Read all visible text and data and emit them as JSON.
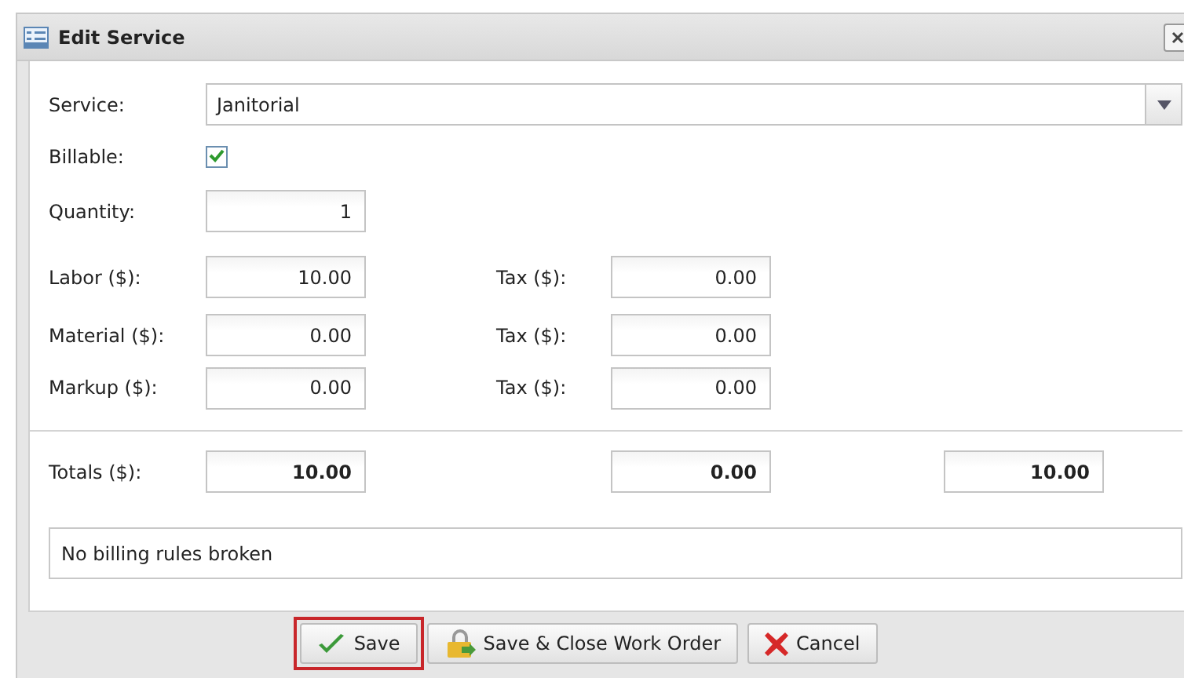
{
  "window": {
    "title": "Edit Service"
  },
  "form": {
    "service": {
      "label": "Service:",
      "value": "Janitorial"
    },
    "billable": {
      "label": "Billable:",
      "checked": true
    },
    "quantity": {
      "label": "Quantity:",
      "value": "1"
    },
    "cost_rows": [
      {
        "label": "Labor ($):",
        "value": "10.00",
        "tax_label": "Tax ($):",
        "tax_value": "0.00"
      },
      {
        "label": "Material ($):",
        "value": "0.00",
        "tax_label": "Tax ($):",
        "tax_value": "0.00"
      },
      {
        "label": "Markup ($):",
        "value": "0.00",
        "tax_label": "Tax ($):",
        "tax_value": "0.00"
      }
    ],
    "totals": {
      "label": "Totals ($):",
      "values": [
        "10.00",
        "0.00",
        "10.00"
      ]
    },
    "message": "No billing rules broken"
  },
  "buttons": [
    {
      "label": "Save",
      "kind": "check",
      "highlighted": true
    },
    {
      "label": "Save & Close Work Order",
      "kind": "lock",
      "highlighted": false
    },
    {
      "label": "Cancel",
      "kind": "cross",
      "highlighted": false
    }
  ]
}
